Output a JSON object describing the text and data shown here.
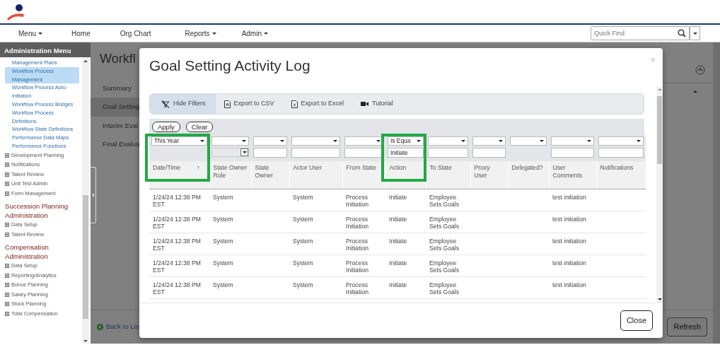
{
  "navbar": {
    "items": [
      {
        "label": "Menu",
        "dropdown": true
      },
      {
        "label": "Home",
        "dropdown": false
      },
      {
        "label": "Org Chart",
        "dropdown": false
      },
      {
        "label": "Reports",
        "dropdown": true
      },
      {
        "label": "Admin",
        "dropdown": true
      }
    ],
    "quick_find": {
      "placeholder": "Quick Find"
    }
  },
  "sidebar": {
    "title": "Administration Menu",
    "sections": [
      {
        "items": [
          {
            "label": "Management Plans",
            "kind": "link",
            "selected": false
          },
          {
            "label": "Workflow Process Management",
            "kind": "link",
            "selected": true
          },
          {
            "label": "Workflow Process Auto-Initiation",
            "kind": "link",
            "selected": false
          },
          {
            "label": "Workflow Process Bridges",
            "kind": "link",
            "selected": false
          },
          {
            "label": "Workflow Process Definitions",
            "kind": "link",
            "selected": false
          },
          {
            "label": "Workflow State Definitions",
            "kind": "link",
            "selected": false
          },
          {
            "label": "Performance Data Maps",
            "kind": "link",
            "selected": false
          },
          {
            "label": "Performance Functions",
            "kind": "link",
            "selected": false
          },
          {
            "label": "Development Planning",
            "kind": "group"
          },
          {
            "label": "Notifications",
            "kind": "group"
          },
          {
            "label": "Talent Review",
            "kind": "group"
          },
          {
            "label": "Unit Test Admin",
            "kind": "group"
          },
          {
            "label": "Form Management",
            "kind": "group"
          }
        ]
      },
      {
        "heading": "Succession Planning Administration",
        "items": [
          {
            "label": "Data Setup",
            "kind": "group"
          },
          {
            "label": "Talent Review",
            "kind": "group"
          }
        ]
      },
      {
        "heading": "Compensation Administration",
        "items": [
          {
            "label": "Data Setup",
            "kind": "group"
          },
          {
            "label": "Reporting/Analytics",
            "kind": "group"
          },
          {
            "label": "Bonus Planning",
            "kind": "group"
          },
          {
            "label": "Salary Planning",
            "kind": "group"
          },
          {
            "label": "Stock Planning",
            "kind": "group"
          },
          {
            "label": "Total Compensation",
            "kind": "group"
          }
        ]
      }
    ]
  },
  "page": {
    "title": "Workfl",
    "tabs": [
      {
        "label": "Summary",
        "selected": false
      },
      {
        "label": "Goal Setting",
        "selected": true
      },
      {
        "label": "Interim Eval",
        "selected": false
      },
      {
        "label": "Final Evalua",
        "selected": false
      }
    ],
    "back_link": "Back to Lis",
    "refresh_button": "Refresh"
  },
  "modal": {
    "title": "Goal Setting Activity Log",
    "close_icon": "×",
    "toolbar": [
      {
        "label": "Hide Filters",
        "kind": "filter",
        "active": true
      },
      {
        "label": "Export to CSV",
        "kind": "csv",
        "active": false
      },
      {
        "label": "Export to Excel",
        "kind": "excel",
        "active": false
      },
      {
        "label": "Tutorial",
        "kind": "video",
        "active": false
      }
    ],
    "apply_button": "Apply",
    "clear_button": "Clear",
    "columns": [
      {
        "label": "Date/Time",
        "kind": "plain",
        "sort_mark": "↑",
        "filter_operator": "This Year",
        "highlighted": true
      },
      {
        "label": "State Owner Role",
        "kind": "picker",
        "highlighted": false
      },
      {
        "label": "State Owner",
        "kind": "text",
        "highlighted": false
      },
      {
        "label": "Actor User",
        "kind": "text",
        "highlighted": false
      },
      {
        "label": "From State",
        "kind": "text",
        "highlighted": false
      },
      {
        "label": "Action",
        "kind": "text",
        "filter_operator": "Is Equa",
        "filter_value": "Initiate",
        "highlighted": true
      },
      {
        "label": "To State",
        "kind": "text",
        "highlighted": false
      },
      {
        "label": "Proxy User",
        "kind": "text",
        "highlighted": false
      },
      {
        "label": "Delegated?",
        "kind": "plain",
        "highlighted": false
      },
      {
        "label": "User Comments",
        "kind": "text",
        "highlighted": false
      },
      {
        "label": "Notifications",
        "kind": "text",
        "highlighted": false
      }
    ],
    "rows": [
      [
        "1/24/24 12:38 PM EST",
        "System",
        null,
        "System",
        "Process Initiation",
        "Initiate",
        "Employee Sets Goals",
        null,
        null,
        "test initiation",
        null
      ],
      [
        "1/24/24 12:38 PM EST",
        "System",
        null,
        "System",
        "Process Initiation",
        "Initiate",
        "Employee Sets Goals",
        null,
        null,
        "test initiation",
        null
      ],
      [
        "1/24/24 12:38 PM EST",
        "System",
        null,
        "System",
        "Process Initiation",
        "Initiate",
        "Employee Sets Goals",
        null,
        null,
        "test initiation",
        null
      ],
      [
        "1/24/24 12:38 PM EST",
        "System",
        null,
        "System",
        "Process Initiation",
        "Initiate",
        "Employee Sets Goals",
        null,
        null,
        "test initiation",
        null
      ],
      [
        "1/24/24 12:38 PM EST",
        "System",
        null,
        "System",
        "Process Initiation",
        "Initiate",
        "Employee Sets Goals",
        null,
        null,
        "test initiation",
        null
      ]
    ],
    "close_button": "Close"
  }
}
